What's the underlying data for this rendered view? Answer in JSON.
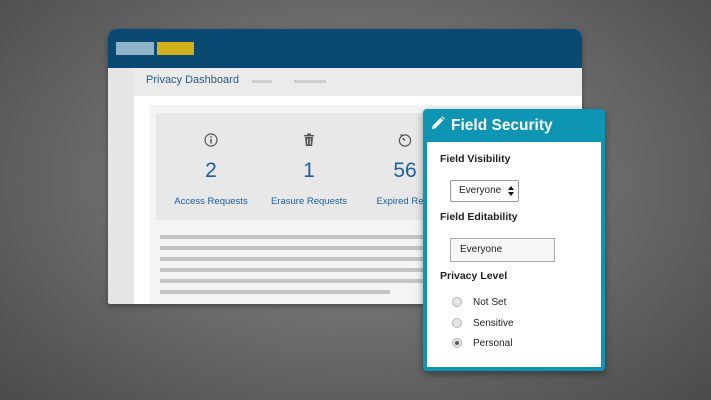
{
  "window": {
    "nav_title": "Privacy Dashboard"
  },
  "stats": [
    {
      "icon": "info-icon",
      "value": "2",
      "label": "Access Requests"
    },
    {
      "icon": "trash-icon",
      "value": "1",
      "label": "Erasure Requests"
    },
    {
      "icon": "timer-icon",
      "value": "56",
      "label": "Expired Reco"
    }
  ],
  "panel": {
    "title": "Field Security",
    "title_icon": "pencil-icon",
    "visibility_label": "Field Visibility",
    "visibility_value": "Everyone",
    "editability_label": "Field Editability",
    "editability_value": "Everyone",
    "privacy_label": "Privacy Level",
    "privacy_options": [
      {
        "label": "Not Set",
        "checked": false
      },
      {
        "label": "Sensitive",
        "checked": false
      },
      {
        "label": "Personal",
        "checked": true
      }
    ]
  },
  "colors": {
    "titlebar": "#0a4a72",
    "accent_gold": "#d1b01c",
    "panel_header": "#0e95b3",
    "stat_text": "#1a5fa0"
  }
}
